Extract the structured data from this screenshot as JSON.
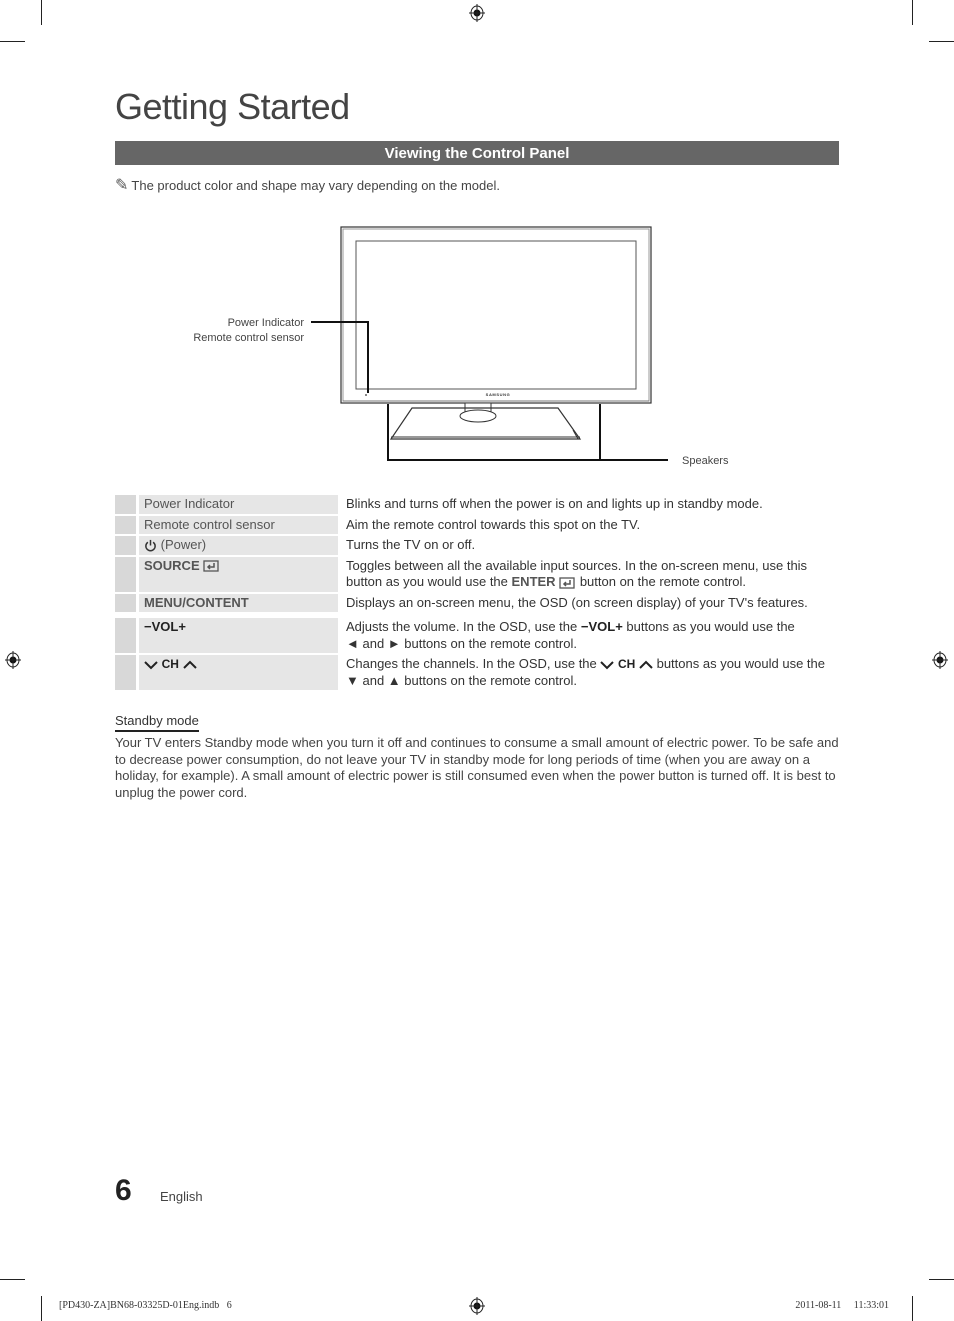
{
  "page": {
    "title": "Getting Started",
    "section_banner": "Viewing the Control Panel",
    "note_icon": "pencil-note-icon",
    "note": "The product color and shape may vary depending on the model."
  },
  "diagram": {
    "brand": "SAMSUNG",
    "callouts": {
      "power_indicator": "Power Indicator",
      "remote_sensor": "Remote control sensor",
      "speakers": "Speakers"
    }
  },
  "controls": [
    {
      "name": "Power Indicator",
      "desc": "Blinks and turns off when the power is on and lights up in standby mode."
    },
    {
      "name": "Remote control sensor",
      "desc": "Aim the remote control towards this spot on the TV."
    },
    {
      "name": "(Power)",
      "icon": "power-icon",
      "desc": "Turns the TV on or off."
    },
    {
      "name": "SOURCE",
      "icon": "source-enter-icon",
      "desc_a": "Toggles between all the available input sources. In the on-screen menu, use this button as you would use the ",
      "desc_bold": "ENTER",
      "desc_b": " button on the remote control."
    },
    {
      "name": "MENU/CONTENT",
      "desc": "Displays an on-screen menu, the OSD (on screen display) of your TV's features."
    },
    {
      "name_minus": "−",
      "name": "VOL",
      "name_plus": "+",
      "desc_a": "Adjusts the volume. In the OSD, use the ",
      "desc_bold": "VOL",
      "desc_b": " buttons as you would use the",
      "desc_c": "◄ and ► buttons on the remote control."
    },
    {
      "name": "CH",
      "icon_down": "chevron-down-icon",
      "icon_up": "chevron-up-icon",
      "desc_a": "Changes the channels. In the OSD, use the ",
      "desc_bold": "CH",
      "desc_b": " buttons as you would use the",
      "desc_c": "▼ and ▲ buttons on the remote control."
    }
  ],
  "standby": {
    "heading": "Standby mode",
    "body": "Your TV enters Standby mode when you turn it off and continues to consume a small amount of electric power. To be safe and to decrease power consumption, do not leave your TV in standby mode for long periods of time (when you are away on a holiday, for example). A small amount of electric power is still consumed even when the power button is turned off. It is best to unplug the power cord."
  },
  "footer": {
    "page_number": "6",
    "language": "English"
  },
  "print_slug": {
    "file": "[PD430-ZA]BN68-03325D-01Eng.indb   6",
    "datetime": "2011-08-11     11:33:01"
  }
}
